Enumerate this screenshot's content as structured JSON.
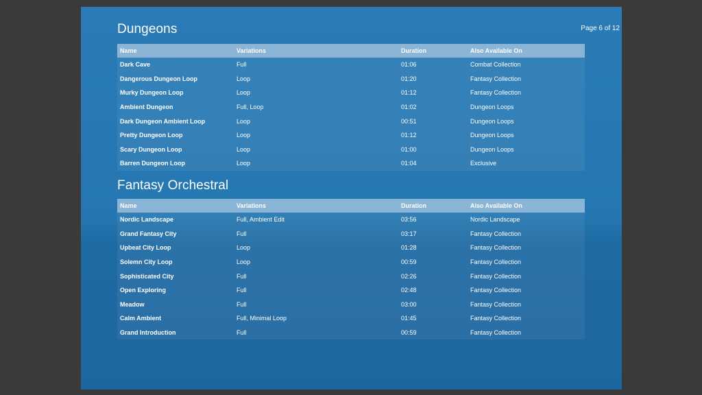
{
  "page_label": "Page 6 of 12",
  "columns": [
    "Name",
    "Variations",
    "Duration",
    "Also Available On"
  ],
  "sections": [
    {
      "title": "Dungeons",
      "rows": [
        [
          "Dark Cave",
          "Full",
          "01:06",
          "Combat Collection"
        ],
        [
          "Dangerous Dungeon Loop",
          "Loop",
          "01:20",
          "Fantasy Collection"
        ],
        [
          "Murky Dungeon Loop",
          "Loop",
          "01:12",
          "Fantasy Collection"
        ],
        [
          "Ambient Dungeon",
          "Full, Loop",
          "01:02",
          "Dungeon Loops"
        ],
        [
          "Dark Dungeon Ambient Loop",
          "Loop",
          "00:51",
          "Dungeon Loops"
        ],
        [
          "Pretty Dungeon Loop",
          "Loop",
          "01:12",
          "Dungeon Loops"
        ],
        [
          "Scary Dungeon Loop",
          "Loop",
          "01:00",
          "Dungeon Loops"
        ],
        [
          "Barren Dungeon Loop",
          "Loop",
          "01:04",
          "Exclusive"
        ]
      ]
    },
    {
      "title": "Fantasy Orchestral",
      "rows": [
        [
          "Nordic Landscape",
          "Full, Ambient Edit",
          "03:56",
          "Nordic Landscape"
        ],
        [
          "Grand Fantasy City",
          "Full",
          "03:17",
          "Fantasy Collection"
        ],
        [
          "Upbeat City Loop",
          "Loop",
          "01:28",
          "Fantasy Collection"
        ],
        [
          "Solemn City Loop",
          "Loop",
          "00:59",
          "Fantasy Collection"
        ],
        [
          "Sophisticated City",
          "Full",
          "02:26",
          "Fantasy Collection"
        ],
        [
          "Open Exploring",
          "Full",
          "02:48",
          "Fantasy Collection"
        ],
        [
          "Meadow",
          "Full",
          "03:00",
          "Fantasy Collection"
        ],
        [
          "Calm Ambient",
          "Full, Minimal Loop",
          "01:45",
          "Fantasy Collection"
        ],
        [
          "Grand Introduction",
          "Full",
          "00:59",
          "Fantasy Collection"
        ]
      ]
    }
  ]
}
